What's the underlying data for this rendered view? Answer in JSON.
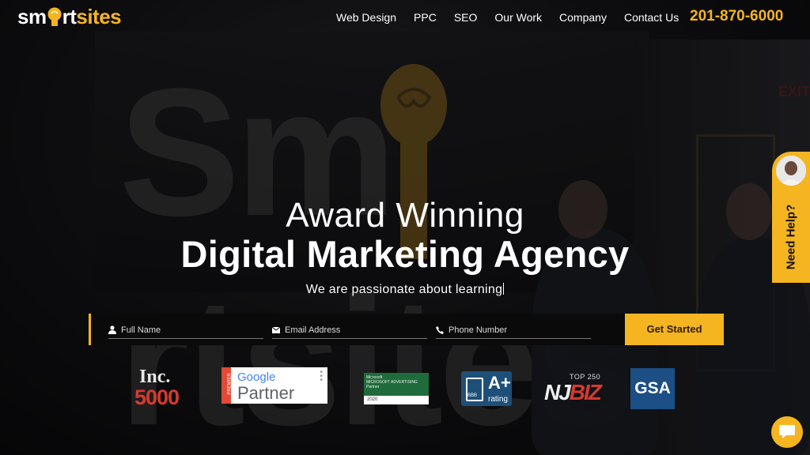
{
  "brand": {
    "logo_white_1": "sm",
    "logo_white_2": "rt",
    "logo_yellow": "sites",
    "accent_color": "#f5b521"
  },
  "nav": {
    "items": [
      "Web Design",
      "PPC",
      "SEO",
      "Our Work",
      "Company",
      "Contact Us"
    ],
    "phone": "201-870-6000"
  },
  "hero": {
    "background_sign_text": "Sm rtsites",
    "background_exit": "EXIT",
    "headline_light": "Award Winning",
    "headline_bold": "Digital Marketing Agency",
    "tagline": "We are passionate about learning"
  },
  "form": {
    "full_name_placeholder": "Full Name",
    "email_placeholder": "Email Address",
    "phone_placeholder": "Phone Number",
    "submit_label": "Get Started"
  },
  "badges": {
    "inc_top": "Inc.",
    "inc_num": "5000",
    "google_premier": "PREMIER",
    "google_word": "Google",
    "google_partner": "Partner",
    "ms_text": "Microsoft\nMICROSOFT ADVERTISING\nPartner",
    "ms_year": "2020",
    "bbb_rating": "A+",
    "bbb_rating_label": "rating",
    "bbb_logo": "BBB",
    "njbiz_top": "TOP 250",
    "njbiz_word": "NJBIZ",
    "gsa": "GSA"
  },
  "help_widget": {
    "label": "Need Help?"
  },
  "icons": {
    "field_name": "user-icon",
    "field_email": "envelope-icon",
    "field_phone": "phone-icon",
    "chat": "chat-bubble-icon"
  }
}
